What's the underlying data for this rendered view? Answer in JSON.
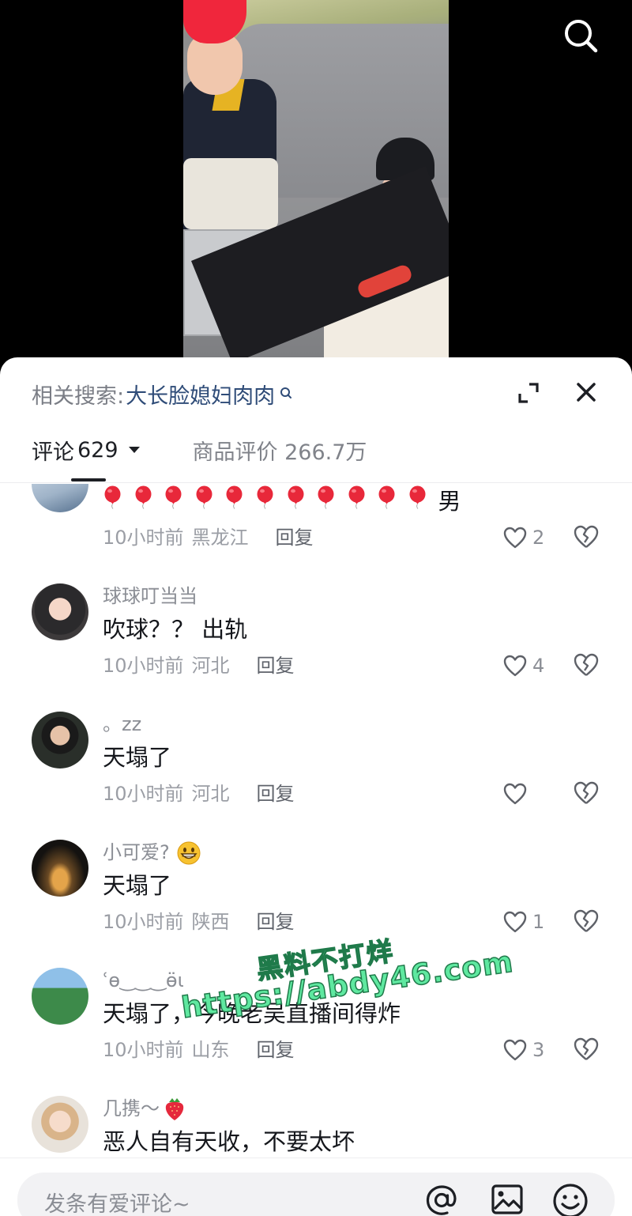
{
  "related_search": {
    "label": "相关搜索:",
    "query": "大长脸媳妇肉肉"
  },
  "tabs": {
    "comments_label": "评论",
    "comments_count": "629",
    "reviews_label": "商品评价 266.7万"
  },
  "comments": [
    {
      "username": "",
      "text_suffix": "男",
      "balloon_count": 11,
      "time": "10小时前",
      "location": "黑龙江",
      "reply": "回复",
      "likes": "2"
    },
    {
      "username": "球球叮当当",
      "text": "吹球？？ 出轨",
      "time": "10小时前",
      "location": "河北",
      "reply": "回复",
      "likes": "4"
    },
    {
      "username": "。zz",
      "text": "天塌了",
      "time": "10小时前",
      "location": "河北",
      "reply": "回复",
      "likes": ""
    },
    {
      "username": "小可爱?",
      "username_emoji": "grinning-face",
      "text": "天塌了",
      "time": "10小时前",
      "location": "陕西",
      "reply": "回复",
      "likes": "1"
    },
    {
      "username": "ʿɵ‿‿‿ɵ̈ɩ",
      "text": "天塌了，今晚老吴直播间得炸",
      "time": "10小时前",
      "location": "山东",
      "reply": "回复",
      "likes": "3"
    },
    {
      "username": "几携～",
      "username_emoji": "strawberry",
      "text": "恶人自有天收，不要太坏",
      "time": "",
      "location": "",
      "reply": "",
      "likes": ""
    }
  ],
  "watermark": {
    "line1": "黑料不打烊",
    "line2": "https://abdy46.com"
  },
  "input": {
    "placeholder": "发条有爱评论~"
  },
  "colors": {
    "link": "#2f4c78",
    "balloon": "#e8283a",
    "watermark": "#5fe8a0"
  }
}
